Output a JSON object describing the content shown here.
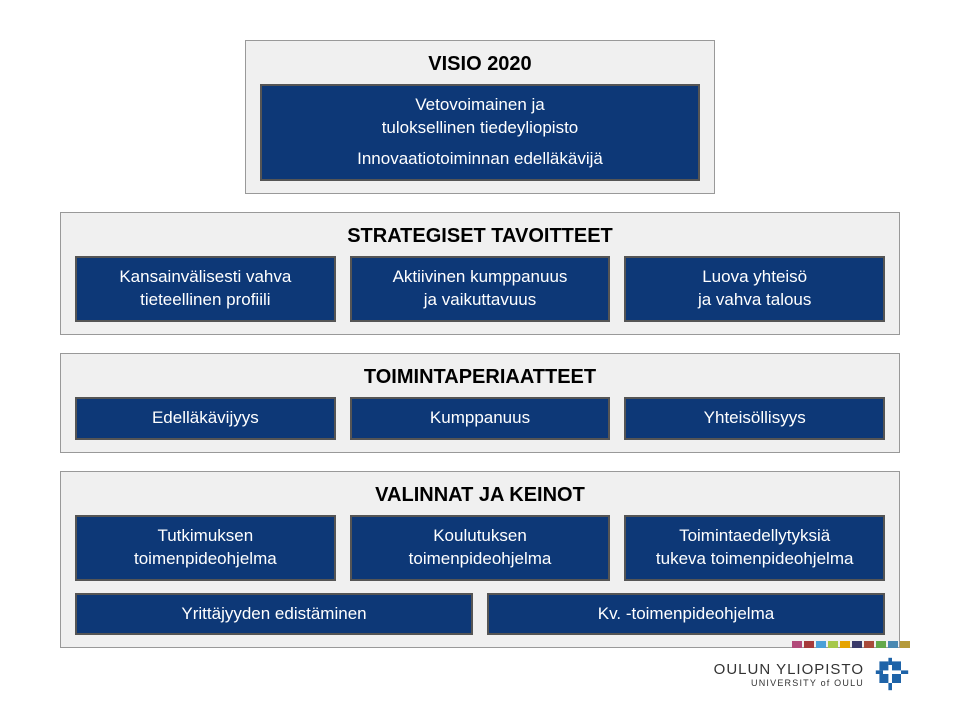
{
  "visio": {
    "title": "VISIO 2020",
    "box_line1": "Vetovoimainen ja",
    "box_line2": "tuloksellinen tiedeyliopisto",
    "subtitle": "Innovaatiotoiminnan edelläkävijä"
  },
  "strategiset": {
    "title": "STRATEGISET TAVOITTEET",
    "items": [
      {
        "line1": "Kansainvälisesti vahva",
        "line2": "tieteellinen profiili"
      },
      {
        "line1": "Aktiivinen kumppanuus",
        "line2": "ja vaikuttavuus"
      },
      {
        "line1": "Luova yhteisö",
        "line2": "ja vahva talous"
      }
    ]
  },
  "toiminta": {
    "title": "TOIMINTAPERIAATTEET",
    "items": [
      {
        "label": "Edelläkävijyys"
      },
      {
        "label": "Kumppanuus"
      },
      {
        "label": "Yhteisöllisyys"
      }
    ]
  },
  "valinnat": {
    "title": "VALINNAT JA KEINOT",
    "row1": [
      {
        "line1": "Tutkimuksen",
        "line2": "toimenpideohjelma"
      },
      {
        "line1": "Koulutuksen",
        "line2": "toimenpideohjelma"
      },
      {
        "line1": "Toimintaedellytyksiä",
        "line2": "tukeva toimenpideohjelma"
      }
    ],
    "row2": [
      {
        "label": "Yrittäjyyden edistäminen"
      },
      {
        "label": "Kv. -toimenpideohjelma"
      }
    ]
  },
  "bars_colors": [
    "#b24a7a",
    "#a63a3a",
    "#4aa0d8",
    "#a6c84a",
    "#e6a300",
    "#3a3a6a",
    "#a84a3a",
    "#63a84a",
    "#4a88b2",
    "#b59a3a"
  ],
  "logo": {
    "name": "OULUN YLIOPISTO",
    "sub": "UNIVERSITY of OULU",
    "color": "#1e63a8"
  }
}
